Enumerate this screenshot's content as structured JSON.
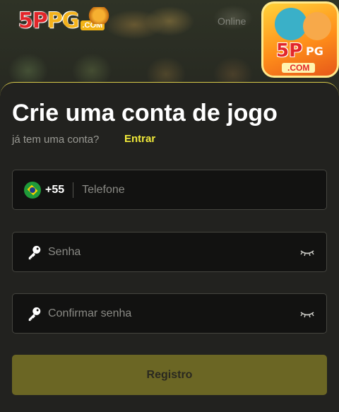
{
  "header": {
    "logo": {
      "main": "5P",
      "secondary": "PG",
      "suffix": ".COM"
    },
    "nav_link": "Online",
    "app_icon": {
      "main": "5P",
      "secondary": "PG",
      "suffix": ".COM"
    }
  },
  "form": {
    "title": "Crie uma conta de jogo",
    "have_account_text": "já tem uma conta?",
    "login_link": "Entrar",
    "phone": {
      "country_code": "+55",
      "country_flag_icon": "brazil-flag-icon",
      "placeholder": "Telefone",
      "value": ""
    },
    "password": {
      "placeholder": "Senha",
      "value": "",
      "icon": "key-icon",
      "toggle_icon": "eye-closed-icon"
    },
    "confirm_password": {
      "placeholder": "Confirmar senha",
      "value": "",
      "icon": "key-icon",
      "toggle_icon": "eye-closed-icon"
    },
    "submit_label": "Registro"
  },
  "colors": {
    "accent": "#f1ea3a",
    "panel_border": "#d8c94a",
    "button_bg": "#6b6624",
    "panel_bg": "#22221f",
    "input_bg": "#121211"
  }
}
